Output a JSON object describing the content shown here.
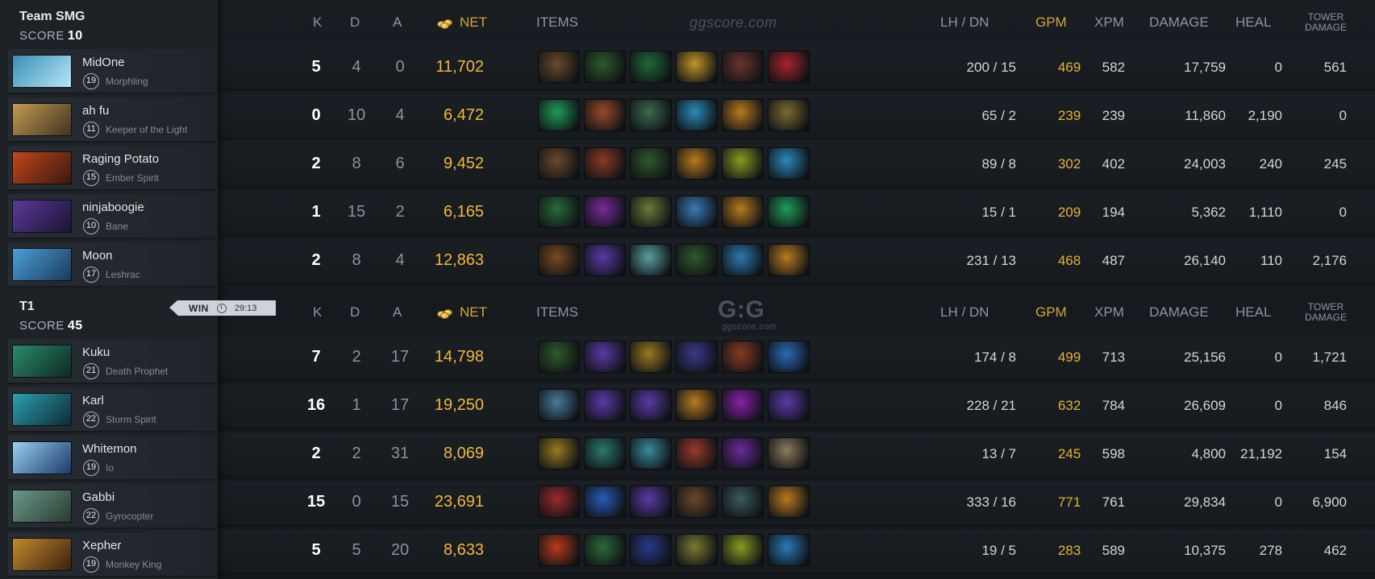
{
  "headers": {
    "k": "K",
    "d": "D",
    "a": "A",
    "net": "NET",
    "items": "ITEMS",
    "lhdn": "LH  /  DN",
    "gpm": "GPM",
    "xpm": "XPM",
    "damage": "DAMAGE",
    "heal": "HEAL",
    "tower1": "TOWER",
    "tower2": "DAMAGE"
  },
  "watermark": {
    "top": "ggscore.com",
    "logo": "G:G",
    "sub": "ggscore.com"
  },
  "teams": [
    {
      "name": "Team SMG",
      "score_label": "SCORE",
      "score": "10",
      "players": [
        {
          "name": "MidOne",
          "level": "19",
          "hero": "Morphling",
          "k": "5",
          "d": "4",
          "a": "0",
          "net": "11,702",
          "lhdn": "200  /  15",
          "gpm": "469",
          "xpm": "582",
          "damage": "17,759",
          "heal": "0",
          "tower": "561",
          "portrait": [
            "#3a8fb8",
            "#b8e6f5"
          ],
          "items": [
            "#6b4a2b",
            "#2e5a2a",
            "#1f6a3a",
            "#c29528",
            "#6a3430",
            "#a8232a"
          ]
        },
        {
          "name": "ah fu",
          "level": "11",
          "hero": "Keeper of the Light",
          "k": "0",
          "d": "10",
          "a": "4",
          "net": "6,472",
          "lhdn": "65  /  2",
          "gpm": "239",
          "xpm": "239",
          "damage": "11,860",
          "heal": "2,190",
          "tower": "0",
          "portrait": [
            "#c59a52",
            "#3e3322"
          ],
          "items": [
            "#1f9b5a",
            "#9a4a2a",
            "#3a6a4e",
            "#2a8ab8",
            "#b87a20",
            "#7a6a30"
          ]
        },
        {
          "name": "Raging Potato",
          "level": "15",
          "hero": "Ember Spirit",
          "k": "2",
          "d": "8",
          "a": "6",
          "net": "9,452",
          "lhdn": "89  /  8",
          "gpm": "302",
          "xpm": "402",
          "damage": "24,003",
          "heal": "240",
          "tower": "245",
          "portrait": [
            "#c2471b",
            "#3a1810"
          ],
          "items": [
            "#6b4a2b",
            "#8a3a22",
            "#2e5a2a",
            "#b87a20",
            "#8a9a20",
            "#2a8ab8"
          ]
        },
        {
          "name": "ninjaboogie",
          "level": "10",
          "hero": "Bane",
          "k": "1",
          "d": "15",
          "a": "2",
          "net": "6,165",
          "lhdn": "15  /  1",
          "gpm": "209",
          "xpm": "194",
          "damage": "5,362",
          "heal": "1,110",
          "tower": "0",
          "portrait": [
            "#5a3a9a",
            "#1a1430"
          ],
          "items": [
            "#2a6a3a",
            "#7a2a9a",
            "#6a7a3a",
            "#3a7ab8",
            "#b87a20",
            "#1f9b5a"
          ]
        },
        {
          "name": "Moon",
          "level": "17",
          "hero": "Leshrac",
          "k": "2",
          "d": "8",
          "a": "4",
          "net": "12,863",
          "lhdn": "231  /  13",
          "gpm": "468",
          "xpm": "487",
          "damage": "26,140",
          "heal": "110",
          "tower": "2,176",
          "portrait": [
            "#4aa0d8",
            "#1a3a5a"
          ],
          "items": [
            "#7a4a20",
            "#5a3aa8",
            "#5aa0a0",
            "#2e5a2a",
            "#2a7ab0",
            "#b87a20"
          ]
        }
      ]
    },
    {
      "name": "T1",
      "score_label": "SCORE",
      "score": "45",
      "players": [
        {
          "name": "Kuku",
          "level": "21",
          "hero": "Death Prophet",
          "k": "7",
          "d": "2",
          "a": "17",
          "net": "14,798",
          "lhdn": "174  /  8",
          "gpm": "499",
          "xpm": "713",
          "damage": "25,156",
          "heal": "0",
          "tower": "1,721",
          "portrait": [
            "#2a8a6a",
            "#0e2a22"
          ],
          "items": [
            "#2e5a2a",
            "#5a3aa8",
            "#9a7a20",
            "#3a3a8a",
            "#8a3a22",
            "#2a6ab8"
          ]
        },
        {
          "name": "Karl",
          "level": "22",
          "hero": "Storm Spirit",
          "k": "16",
          "d": "1",
          "a": "17",
          "net": "19,250",
          "lhdn": "228  /  21",
          "gpm": "632",
          "xpm": "784",
          "damage": "26,609",
          "heal": "0",
          "tower": "846",
          "portrait": [
            "#2aa0b0",
            "#0e2a35"
          ],
          "items": [
            "#4a7a9a",
            "#5a3aa8",
            "#5a3aa8",
            "#b87a20",
            "#8a20a8",
            "#5a3aa8"
          ]
        },
        {
          "name": "Whitemon",
          "level": "19",
          "hero": "Io",
          "k": "2",
          "d": "2",
          "a": "31",
          "net": "8,069",
          "lhdn": "13  /  7",
          "gpm": "245",
          "xpm": "598",
          "damage": "4,800",
          "heal": "21,192",
          "tower": "154",
          "portrait": [
            "#9ad0f0",
            "#1a3a6a"
          ],
          "items": [
            "#9a7a20",
            "#2a7a6a",
            "#3a8a9a",
            "#9a3a2a",
            "#6a2a9a",
            "#8a7a5a"
          ]
        },
        {
          "name": "Gabbi",
          "level": "22",
          "hero": "Gyrocopter",
          "k": "15",
          "d": "0",
          "a": "15",
          "net": "23,691",
          "lhdn": "333  /  16",
          "gpm": "771",
          "xpm": "761",
          "damage": "29,834",
          "heal": "0",
          "tower": "6,900",
          "portrait": [
            "#6a9a8a",
            "#2a3a30"
          ],
          "items": [
            "#9a2a2a",
            "#2a5ab8",
            "#5a3aa8",
            "#6b4a2b",
            "#3a5a5a",
            "#b87a20"
          ]
        },
        {
          "name": "Xepher",
          "level": "19",
          "hero": "Monkey King",
          "k": "5",
          "d": "5",
          "a": "20",
          "net": "8,633",
          "lhdn": "19  /  5",
          "gpm": "283",
          "xpm": "589",
          "damage": "10,375",
          "heal": "278",
          "tower": "462",
          "portrait": [
            "#c28a2a",
            "#3a2010"
          ],
          "items": [
            "#b83a1a",
            "#2a6a3a",
            "#2a3a8a",
            "#7a7a30",
            "#8a9a20",
            "#2a7ab8"
          ]
        }
      ]
    }
  ],
  "result": {
    "label": "WIN",
    "duration": "29:13"
  }
}
